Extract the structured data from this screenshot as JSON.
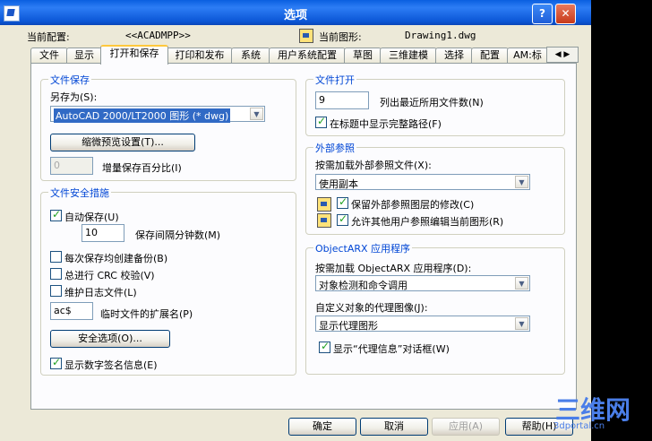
{
  "window": {
    "title": "选项"
  },
  "header": {
    "current_config_label": "当前配置:",
    "current_config_value": "<<ACADMPP>>",
    "current_drawing_label": "当前图形:",
    "current_drawing_value": "Drawing1.dwg"
  },
  "tabs": [
    "文件",
    "显示",
    "打开和保存",
    "打印和发布",
    "系统",
    "用户系统配置",
    "草图",
    "三维建模",
    "选择",
    "配置",
    "AM:标"
  ],
  "file_save": {
    "title": "文件保存",
    "save_as_label": "另存为(S):",
    "save_as_value": "AutoCAD 2000/LT2000 图形 (* dwg)",
    "thumbnail_button": "缩微预览设置(T)...",
    "incremental_value": "0",
    "incremental_label": "增量保存百分比(I)"
  },
  "file_safety": {
    "title": "文件安全措施",
    "autosave_label": "自动保存(U)",
    "interval_value": "10",
    "interval_label": "保存间隔分钟数(M)",
    "backup_label": "每次保存均创建备份(B)",
    "crc_label": "总进行 CRC 校验(V)",
    "log_label": "维护日志文件(L)",
    "ext_value": "ac$",
    "ext_label": "临时文件的扩展名(P)",
    "security_button": "安全选项(O)...",
    "digital_sig_label": "显示数字签名信息(E)"
  },
  "file_open": {
    "title": "文件打开",
    "recent_value": "9",
    "recent_label": "列出最近所用文件数(N)",
    "fullpath_label": "在标题中显示完整路径(F)"
  },
  "xref": {
    "title": "外部参照",
    "demand_label": "按需加载外部参照文件(X):",
    "demand_value": "使用副本",
    "retain_label": "保留外部参照图层的修改(C)",
    "allow_label": "允许其他用户参照编辑当前图形(R)"
  },
  "objectarx": {
    "title": "ObjectARX 应用程序",
    "demand_label": "按需加载 ObjectARX 应用程序(D):",
    "demand_value": "对象检测和命令调用",
    "proxy_label": "自定义对象的代理图像(J):",
    "proxy_value": "显示代理图形",
    "proxy_info_label": "显示“代理信息”对话框(W)"
  },
  "footer": {
    "ok": "确定",
    "cancel": "取消",
    "apply": "应用(A)",
    "help": "帮助(H)"
  },
  "watermark": {
    "main": "三维网",
    "sub": "3dportal.cn"
  }
}
